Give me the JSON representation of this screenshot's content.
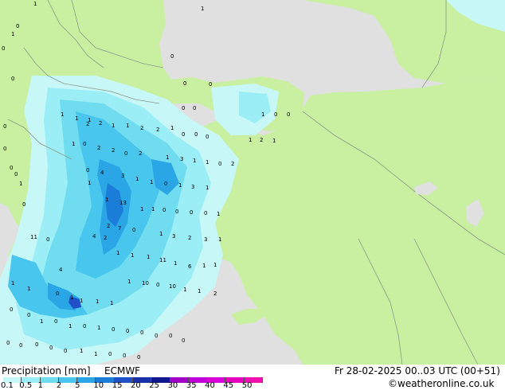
{
  "footer": {
    "title": "Precipitation [mm]",
    "model": "ECMWF",
    "valid": "Fr 28-02-2025 00..03 UTC (00+51)",
    "credit": "©weatheronline.co.uk"
  },
  "colors": {
    "sea": "#e0e0e0",
    "land": "#c8f0a0",
    "border": "#8a9a88",
    "p01": "#c8f7f7",
    "p05": "#9beef5",
    "p1": "#6fdcf0",
    "p2": "#48c6ee",
    "p5": "#2aa6e6",
    "p10": "#1a7ed8",
    "p15": "#2050c8"
  },
  "legend": {
    "labels": [
      "0.1",
      "0.5",
      "1",
      "2",
      "5",
      "10",
      "15",
      "20",
      "25",
      "30",
      "35",
      "40",
      "45",
      "50"
    ],
    "colors": [
      "#c8f7f7",
      "#9beef5",
      "#6fdcf0",
      "#48c6ee",
      "#2aa6e6",
      "#1a7ed8",
      "#2050c8",
      "#1830a8",
      "#101890",
      "#a000c8",
      "#c000d8",
      "#d800d8",
      "#e800c0",
      "#f010b0"
    ]
  },
  "map_labels": [
    "1",
    "1",
    "0",
    "1",
    "0",
    "0",
    "0",
    "0",
    "1",
    "1",
    "1",
    "0",
    "0",
    "0",
    "0",
    "1",
    "0",
    "0",
    "2",
    "1",
    "2",
    "1",
    "2",
    "2",
    "1",
    "0",
    "0",
    "0",
    "1",
    "0",
    "2",
    "2",
    "0",
    "2",
    "1",
    "3",
    "1",
    "1",
    "0",
    "2",
    "1",
    "2",
    "1",
    "0",
    "4",
    "3",
    "1",
    "1",
    "0",
    "1",
    "3",
    "1",
    "1",
    "1",
    "13",
    "1",
    "1",
    "0",
    "0",
    "0",
    "0",
    "1",
    "0",
    "1",
    "0",
    "0",
    "0",
    "11",
    "0",
    "2",
    "7",
    "0",
    "1",
    "3",
    "2",
    "3",
    "1",
    "4",
    "2",
    "1",
    "1",
    "1",
    "11",
    "1",
    "6",
    "1",
    "1",
    "1",
    "1",
    "4",
    "1",
    "10",
    "0",
    "10",
    "1",
    "1",
    "2",
    "0",
    "1",
    "1",
    "1",
    "1",
    "0",
    "0",
    "1",
    "0",
    "1",
    "0",
    "1",
    "0",
    "0",
    "0",
    "0",
    "0",
    "0",
    "0",
    "0",
    "0",
    "0",
    "0",
    "1",
    "1",
    "0",
    "0",
    "0"
  ]
}
